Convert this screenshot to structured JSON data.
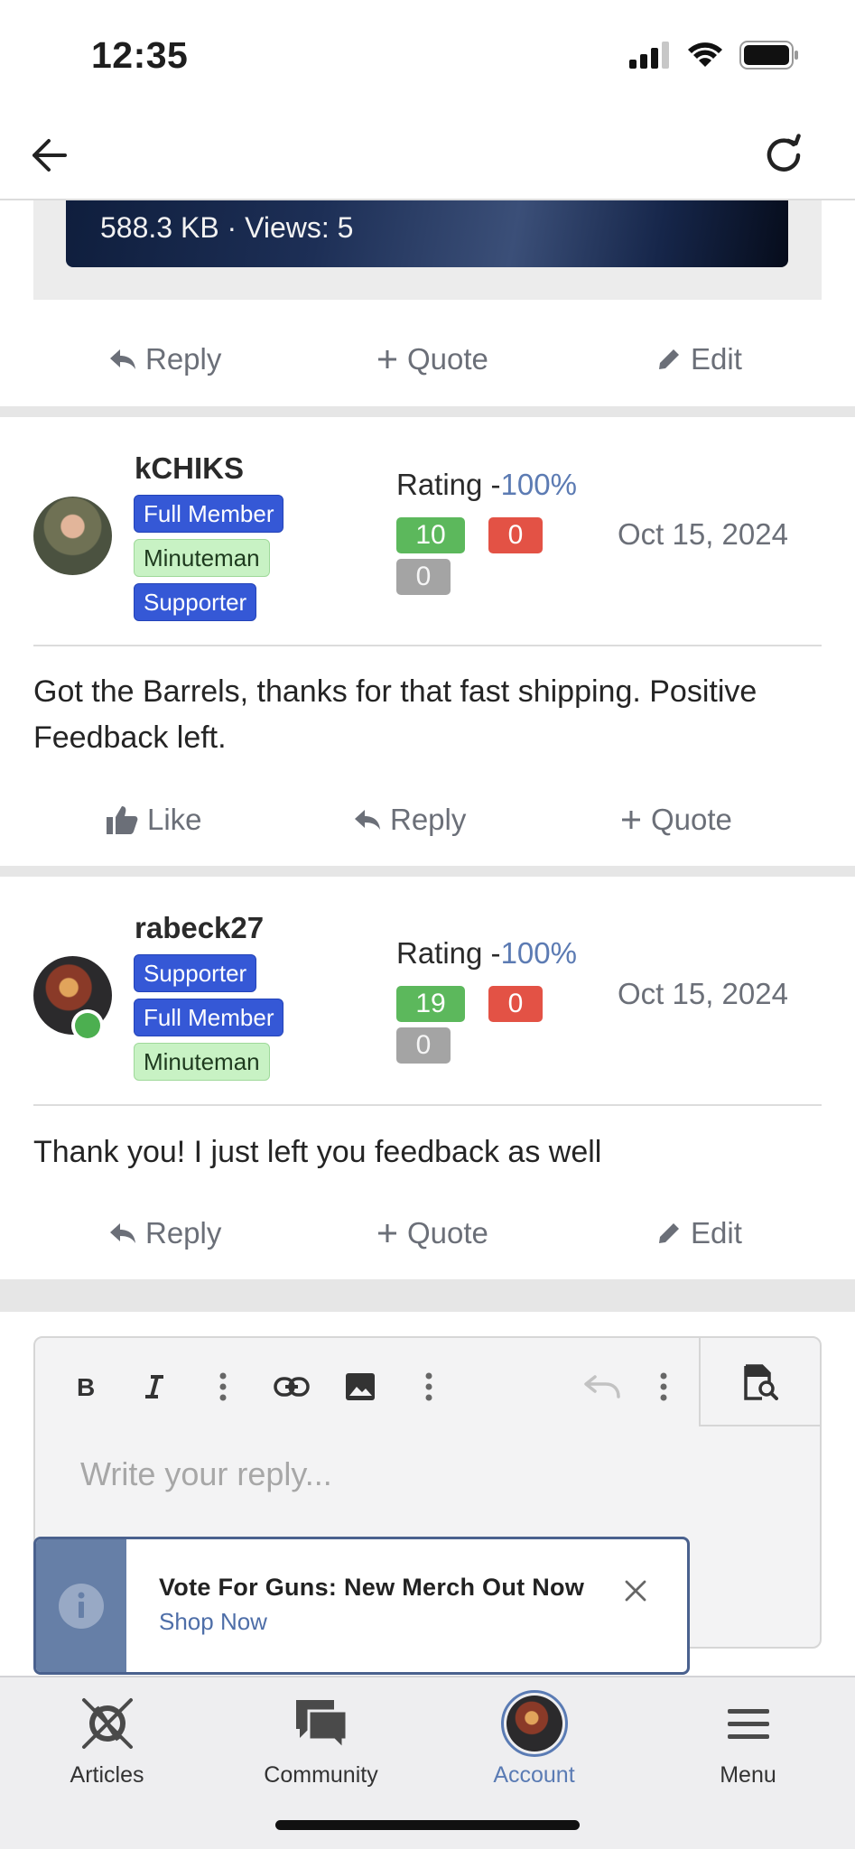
{
  "status_bar": {
    "time": "12:35"
  },
  "header": {
    "back_icon": "arrow-left-icon",
    "refresh_icon": "refresh-icon"
  },
  "attachment": {
    "meta": "588.3 KB · Views: 5"
  },
  "first_actions": {
    "reply": "Reply",
    "quote": "Quote",
    "edit": "Edit"
  },
  "posts": [
    {
      "username": "kCHIKS",
      "badges": [
        "Full Member",
        "Minuteman",
        "Supporter"
      ],
      "rating_label": "Rating -",
      "rating_pct": "100%",
      "positive": "10",
      "negative": "0",
      "neutral": "0",
      "date": "Oct 15, 2024",
      "body": "Got the Barrels, thanks for that fast shipping. Positive Feedback left.",
      "actions": {
        "like": "Like",
        "reply": "Reply",
        "quote": "Quote"
      }
    },
    {
      "username": "rabeck27",
      "badges": [
        "Supporter",
        "Full Member",
        "Minuteman"
      ],
      "rating_label": "Rating -",
      "rating_pct": "100%",
      "positive": "19",
      "negative": "0",
      "neutral": "0",
      "date": "Oct 15, 2024",
      "body": "Thank you! I just left you feedback as well",
      "actions": {
        "reply": "Reply",
        "quote": "Quote",
        "edit": "Edit"
      }
    }
  ],
  "editor": {
    "placeholder": "Write your reply...",
    "tools": [
      "bold-icon",
      "italic-icon",
      "more-icon",
      "link-icon",
      "image-icon",
      "more-icon",
      "undo-icon",
      "more-icon",
      "preview-icon"
    ]
  },
  "toast": {
    "title": "Vote For Guns: New Merch Out Now",
    "link": "Shop Now"
  },
  "tabbar": {
    "articles": "Articles",
    "community": "Community",
    "account": "Account",
    "menu": "Menu",
    "active": "account"
  },
  "colors": {
    "badge_blue": "#3558d6",
    "badge_green": "#c8f2c4",
    "rating_positive": "#5cb85c",
    "rating_negative": "#e35245",
    "rating_neutral": "#a4a4a4",
    "accent": "#5a7bb4"
  }
}
